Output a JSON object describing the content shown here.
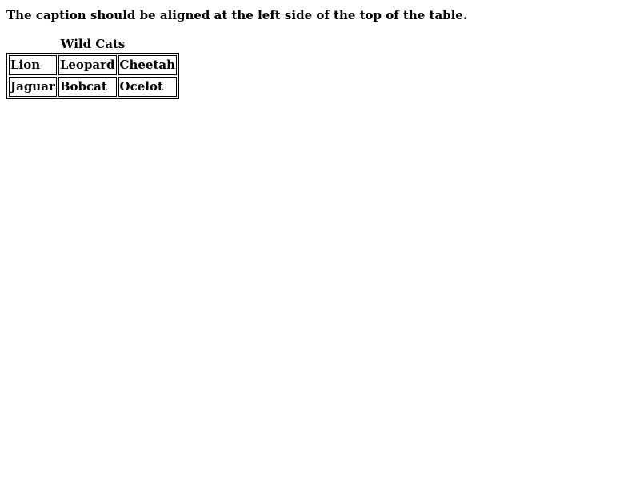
{
  "instruction": "The caption should be aligned at the left side of the top of the table.",
  "table": {
    "caption": "Wild Cats",
    "rows": [
      [
        "Lion",
        "Leopard",
        "Cheetah"
      ],
      [
        "Jaguar",
        "Bobcat",
        "Ocelot"
      ]
    ]
  }
}
